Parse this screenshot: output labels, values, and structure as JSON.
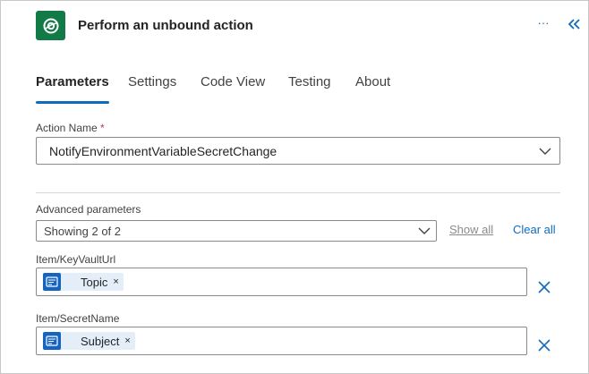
{
  "header": {
    "title": "Perform an unbound action",
    "app_icon": "dataverse-icon",
    "more_label": "···",
    "collapse_icon": "chevron-double-left-icon"
  },
  "tabs": [
    {
      "label": "Parameters",
      "active": true
    },
    {
      "label": "Settings",
      "active": false
    },
    {
      "label": "Code View",
      "active": false
    },
    {
      "label": "Testing",
      "active": false
    },
    {
      "label": "About",
      "active": false
    }
  ],
  "action_name": {
    "label": "Action Name",
    "required_mark": "*",
    "value": "NotifyEnvironmentVariableSecretChange"
  },
  "advanced": {
    "label": "Advanced parameters",
    "value": "Showing 2 of 2",
    "show_all": "Show all",
    "clear_all": "Clear all"
  },
  "fields": [
    {
      "label": "Item/KeyVaultUrl",
      "token": "Topic",
      "token_remove": "×"
    },
    {
      "label": "Item/SecretName",
      "token": "Subject",
      "token_remove": "×"
    }
  ],
  "colors": {
    "accent": "#0f6cbd",
    "app_icon_bg": "#117a46",
    "token_bg": "#e3eef9",
    "token_icon_bg": "#1565c0",
    "required": "#c4314b"
  }
}
